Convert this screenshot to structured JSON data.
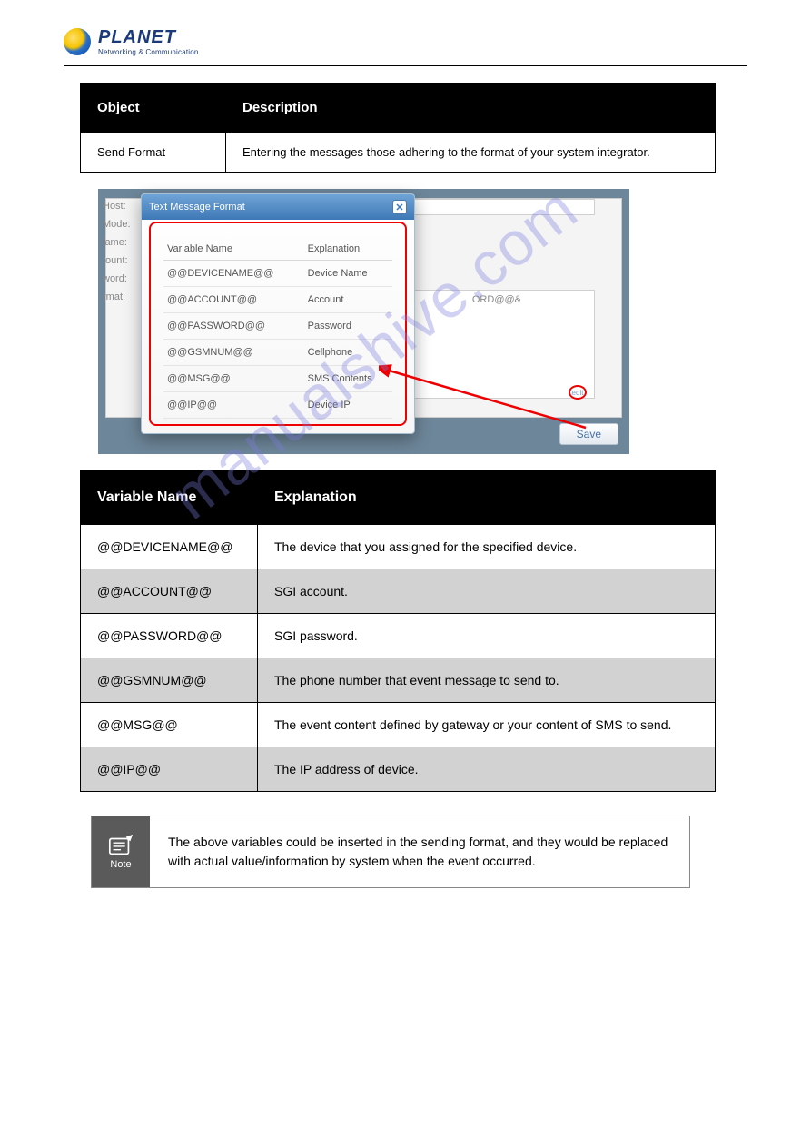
{
  "logo": {
    "brand": "PLANET",
    "tagline": "Networking & Communication"
  },
  "table1": {
    "headers": {
      "object": "Object",
      "description": "Description"
    },
    "row": {
      "object": "Send Format",
      "description": "Entering the messages those adhering to the format of your system integrator."
    }
  },
  "screenshot": {
    "popup_title": "Text Message Format",
    "labels": {
      "host": "Host:",
      "mode": "Mode:",
      "name": "lame:",
      "account": ":ount:",
      "password": "word:",
      "format": "rmat:"
    },
    "bigfield_fragment": "ORD@@&",
    "save": "Save",
    "edit": "edit",
    "popup_headers": {
      "var": "Variable Name",
      "exp": "Explanation"
    },
    "popup_rows": [
      {
        "var": "@@DEVICENAME@@",
        "exp": "Device Name"
      },
      {
        "var": "@@ACCOUNT@@",
        "exp": "Account"
      },
      {
        "var": "@@PASSWORD@@",
        "exp": "Password"
      },
      {
        "var": "@@GSMNUM@@",
        "exp": "Cellphone"
      },
      {
        "var": "@@MSG@@",
        "exp": "SMS Contents"
      },
      {
        "var": "@@IP@@",
        "exp": "Device IP"
      }
    ]
  },
  "table2": {
    "headers": {
      "var": "Variable Name",
      "exp": "Explanation"
    },
    "rows": [
      {
        "var": "@@DEVICENAME@@",
        "exp": "The device that you assigned for the specified device."
      },
      {
        "var": "@@ACCOUNT@@",
        "exp": "SGI account."
      },
      {
        "var": "@@PASSWORD@@",
        "exp": "SGI password."
      },
      {
        "var": "@@GSMNUM@@",
        "exp": "The phone number that event message to send to."
      },
      {
        "var": "@@MSG@@",
        "exp": "The event content defined by gateway or your content of SMS to send."
      },
      {
        "var": "@@IP@@",
        "exp": "The IP address of device."
      }
    ]
  },
  "note": "The above variables could be inserted in the sending format, and they would be replaced with actual value/information by system when the event occurred."
}
